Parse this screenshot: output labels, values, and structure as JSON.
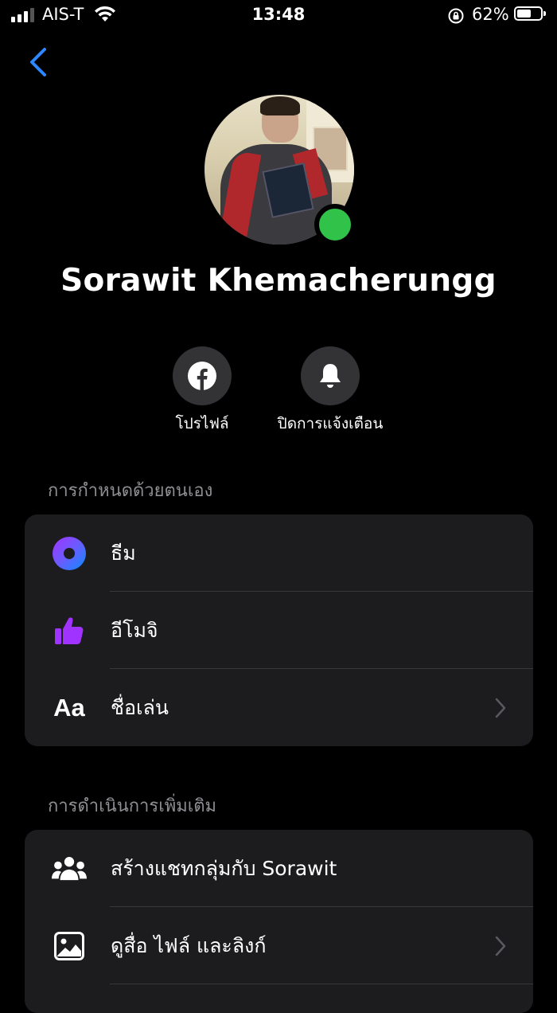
{
  "status_bar": {
    "carrier": "AIS-T",
    "time": "13:48",
    "battery_percent": "62%",
    "battery_level": 0.62,
    "signal_bars": 3
  },
  "header": {
    "back_icon": "chevron-left-icon"
  },
  "profile": {
    "name": "Sorawit Khemacherungg",
    "online": true,
    "online_color": "#31c24a"
  },
  "actions": [
    {
      "label": "โปรไฟล์",
      "icon": "facebook-icon"
    },
    {
      "label": "ปิดการแจ้งเตือน",
      "icon": "bell-icon"
    }
  ],
  "sections": {
    "customize": {
      "title": "การกำหนดด้วยตนเอง",
      "items": [
        {
          "label": "ธีม",
          "icon": "theme-icon"
        },
        {
          "label": "อีโมจิ",
          "icon": "thumbs-up-icon"
        },
        {
          "label": "ชื่อเล่น",
          "icon": "aa-text-icon",
          "icon_text": "Aa"
        }
      ]
    },
    "more_actions": {
      "title": "การดำเนินการเพิ่มเติม",
      "items": [
        {
          "label": "สร้างแชทกลุ่มกับ Sorawit",
          "icon": "group-icon"
        },
        {
          "label": "ดูสื่อ ไฟล์ และลิงก์",
          "icon": "image-icon"
        }
      ]
    }
  },
  "colors": {
    "accent_blue": "#2d88ff",
    "card_bg": "#1c1c1e",
    "secondary_text": "#8e8e93",
    "emoji_purple": "#a033ff"
  }
}
